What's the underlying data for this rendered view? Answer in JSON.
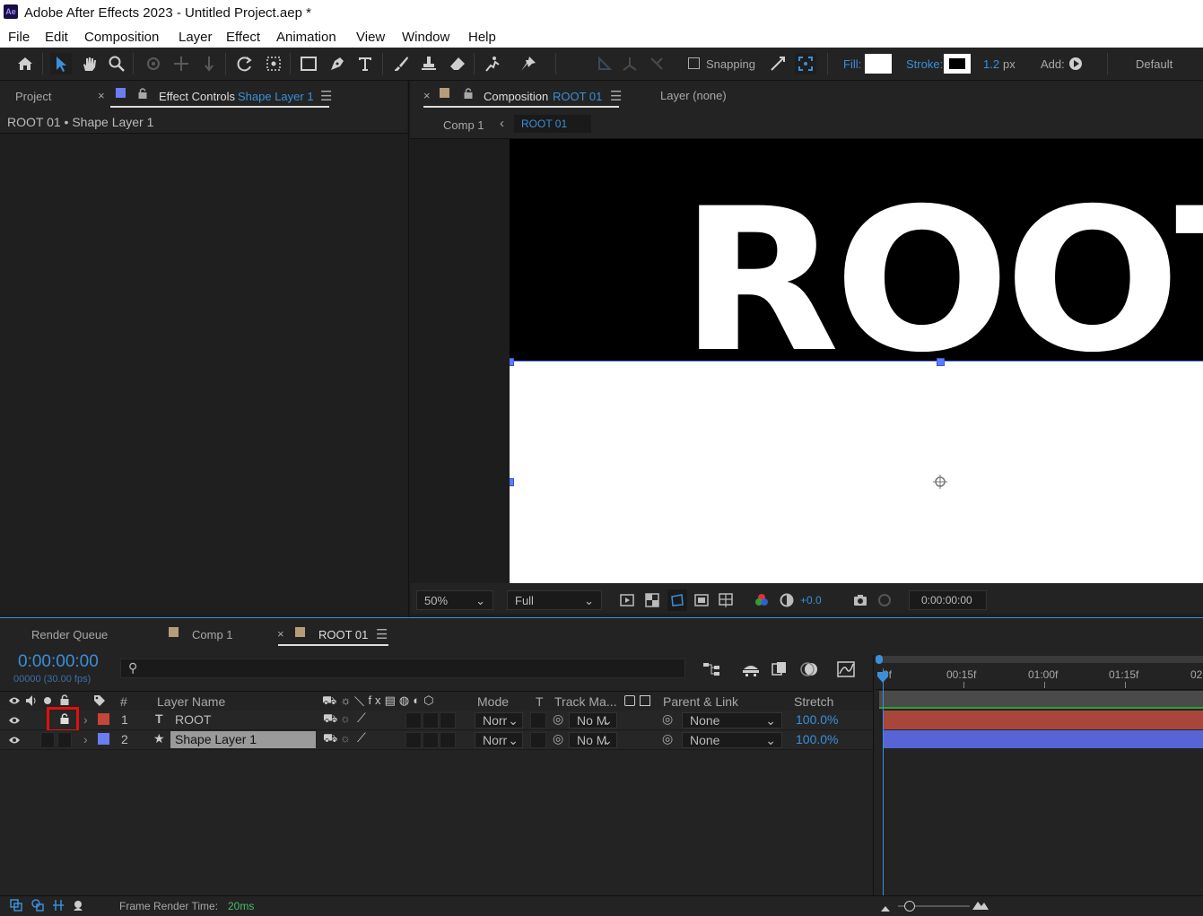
{
  "app": {
    "logo_text": "Ae",
    "title": "Adobe After Effects 2023 - Untitled Project.aep *"
  },
  "menu": [
    "File",
    "Edit",
    "Composition",
    "Layer",
    "Effect",
    "Animation",
    "View",
    "Window",
    "Help"
  ],
  "toolbar": {
    "snapping_label": "Snapping",
    "fill_label": "Fill:",
    "stroke_label": "Stroke:",
    "stroke_width": "1.2",
    "stroke_unit": "px",
    "add_label": "Add:",
    "workspace": "Default"
  },
  "left_panel": {
    "tab_project": "Project",
    "tab_effect_controls": "Effect Controls",
    "tab_effect_controls_target": "Shape Layer 1",
    "breadcrumb": "ROOT 01 • Shape Layer 1"
  },
  "viewer": {
    "tab_composition": "Composition",
    "tab_composition_name": "ROOT 01",
    "tab_layer": "Layer (none)",
    "crumb_parent": "Comp 1",
    "crumb_current": "ROOT 01",
    "canvas_text": "ROOT",
    "zoom": "50%",
    "resolution": "Full",
    "exposure": "+0.0",
    "timecode": "0:00:00:00"
  },
  "timeline": {
    "tabs": [
      "Render Queue",
      "Comp 1",
      "ROOT 01"
    ],
    "current_time": "0:00:00:00",
    "frame_info": "00000 (30.00 fps)",
    "search_placeholder": "",
    "columns": {
      "number": "#",
      "layer_name": "Layer Name",
      "mode": "Mode",
      "t": "T",
      "track_matte": "Track Ma...",
      "parent": "Parent & Link",
      "stretch": "Stretch"
    },
    "ruler": [
      "0f",
      "00:15f",
      "01:00f",
      "01:15f",
      "02"
    ],
    "layers": [
      {
        "index": "1",
        "type_glyph": "T",
        "name": "ROOT",
        "mode": "Norr",
        "matte": "No M",
        "parent": "None",
        "stretch": "100.0%",
        "label_color": "#c4453a",
        "locked": true
      },
      {
        "index": "2",
        "type_glyph": "★",
        "name": "Shape Layer 1",
        "mode": "Norr",
        "matte": "No M",
        "parent": "None",
        "stretch": "100.0%",
        "label_color": "#6b7df0",
        "locked": false
      }
    ],
    "frame_render_label": "Frame Render Time:",
    "frame_render_value": "20ms"
  },
  "colors": {
    "accent": "#3b8fd9",
    "highlight": "#e01010",
    "track_root": "#a8463c",
    "track_shape": "#5664d6"
  }
}
